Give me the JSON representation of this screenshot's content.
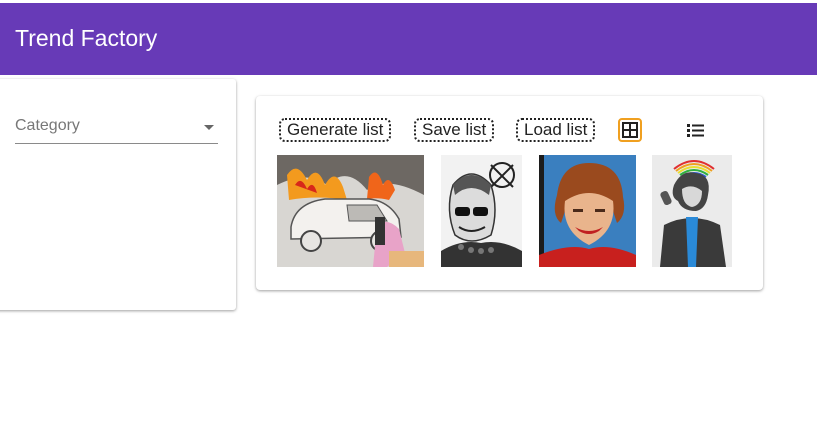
{
  "app": {
    "title": "Trend Factory"
  },
  "sidebar": {
    "category": {
      "placeholder": "Category",
      "icon": "arrow-drop-down-icon"
    }
  },
  "toolbar": {
    "generate_label": "Generate list",
    "save_label": "Save list",
    "load_label": "Load list",
    "grid_icon": "grid-view-icon",
    "list_icon": "list-view-icon",
    "active_view": "grid"
  },
  "colors": {
    "appbar": "#673ab7",
    "active_outline": "#f0a020"
  },
  "gallery": {
    "items": [
      {
        "subject": "burning car drawing"
      },
      {
        "subject": "woman with sunglasses sketch"
      },
      {
        "subject": "red-haired woman painting"
      },
      {
        "subject": "singer with rainbow sketch"
      }
    ]
  }
}
